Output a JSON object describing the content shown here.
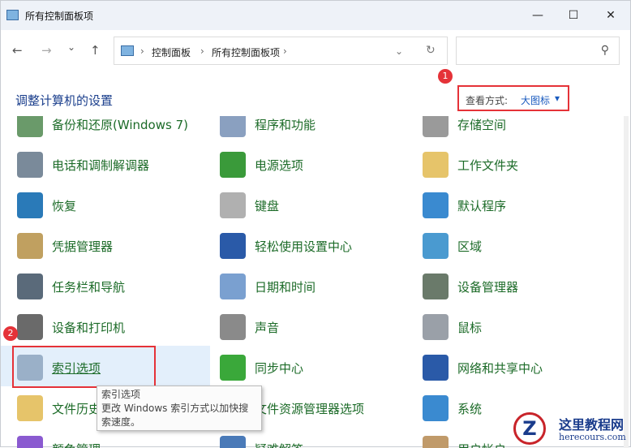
{
  "window": {
    "title": "所有控制面板项",
    "minimize": "—",
    "maximize": "☐",
    "close": "✕"
  },
  "nav": {
    "back": "←",
    "forward": "→",
    "recent": "⌄",
    "up": "↑",
    "refresh": "↻",
    "dropdown": "⌄"
  },
  "breadcrumb": [
    "控制面板",
    "所有控制面板项"
  ],
  "search": {
    "placeholder": "",
    "icon": "⚲"
  },
  "heading": "调整计算机的设置",
  "view": {
    "label": "查看方式:",
    "value": "大图标",
    "arrow": "▾"
  },
  "badges": [
    "1",
    "2"
  ],
  "items": [
    {
      "label": "备份和还原(Windows 7)",
      "color": "#6a9a6a"
    },
    {
      "label": "程序和功能",
      "color": "#8aa0c0"
    },
    {
      "label": "存储空间",
      "color": "#9a9a9a"
    },
    {
      "label": "电话和调制解调器",
      "color": "#7a8a9a"
    },
    {
      "label": "电源选项",
      "color": "#3a9a3a"
    },
    {
      "label": "工作文件夹",
      "color": "#e6c46a"
    },
    {
      "label": "恢复",
      "color": "#2a7ab8"
    },
    {
      "label": "键盘",
      "color": "#b0b0b0"
    },
    {
      "label": "默认程序",
      "color": "#3a8ad0"
    },
    {
      "label": "凭据管理器",
      "color": "#c0a060"
    },
    {
      "label": "轻松使用设置中心",
      "color": "#2a5aa8"
    },
    {
      "label": "区域",
      "color": "#4a9ad0"
    },
    {
      "label": "任务栏和导航",
      "color": "#5a6a7a"
    },
    {
      "label": "日期和时间",
      "color": "#7aa0d0"
    },
    {
      "label": "设备管理器",
      "color": "#6a7a6a"
    },
    {
      "label": "设备和打印机",
      "color": "#6a6a6a"
    },
    {
      "label": "声音",
      "color": "#8a8a8a"
    },
    {
      "label": "鼠标",
      "color": "#9aa0a8"
    },
    {
      "label": "索引选项",
      "color": "#9ab0c8"
    },
    {
      "label": "同步中心",
      "color": "#3aa83a"
    },
    {
      "label": "网络和共享中心",
      "color": "#2a5aa8"
    },
    {
      "label": "文件历史记录",
      "color": "#e6c46a"
    },
    {
      "label": "文件资源管理器选项",
      "color": "#e6c46a"
    },
    {
      "label": "系统",
      "color": "#3a8ad0"
    },
    {
      "label": "颜色管理",
      "color": "#8a5ad0"
    },
    {
      "label": "疑难解答",
      "color": "#4a7ab8"
    },
    {
      "label": "用户帐户",
      "color": "#c09a6a"
    }
  ],
  "tooltip": {
    "title": "索引选项",
    "text": "更改 Windows 索引方式以加快搜索速度。"
  },
  "watermark": {
    "name": "这里教程网",
    "url": "herecours.com",
    "logo": "Z"
  }
}
